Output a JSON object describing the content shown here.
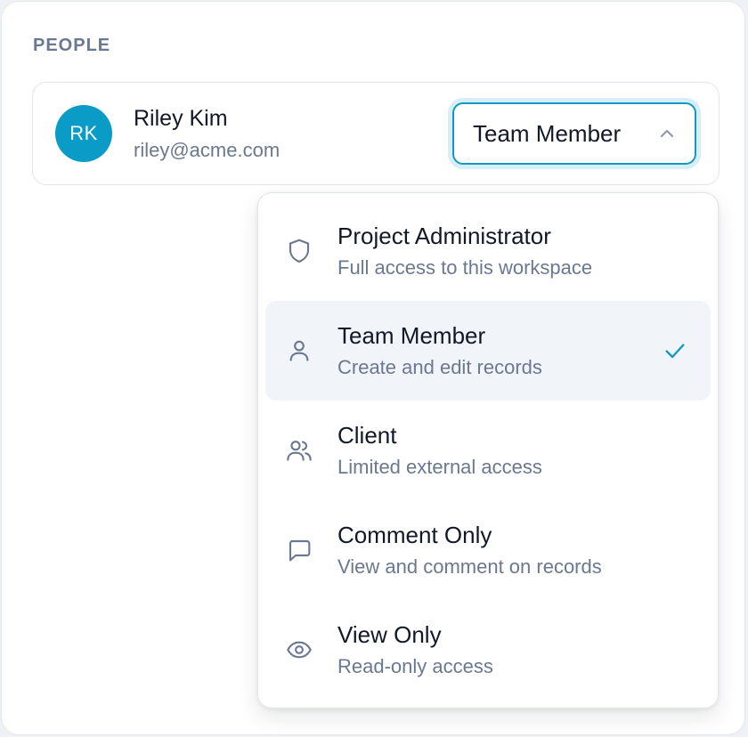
{
  "section": {
    "title": "PEOPLE"
  },
  "person": {
    "initials": "RK",
    "name": "Riley Kim",
    "email": "riley@acme.com",
    "avatar_color": "#0a9cc6"
  },
  "role_select": {
    "value": "Team Member",
    "expanded": true,
    "accent_color": "#1498c0"
  },
  "menu": {
    "items": [
      {
        "title": "Project Administrator",
        "description": "Full access to this workspace",
        "icon": "shield-icon",
        "selected": false
      },
      {
        "title": "Team Member",
        "description": "Create and edit records",
        "icon": "user-icon",
        "selected": true
      },
      {
        "title": "Client",
        "description": "Limited external access",
        "icon": "users-icon",
        "selected": false
      },
      {
        "title": "Comment Only",
        "description": "View and comment on records",
        "icon": "message-icon",
        "selected": false
      },
      {
        "title": "View Only",
        "description": "Read-only access",
        "icon": "eye-icon",
        "selected": false
      }
    ]
  }
}
